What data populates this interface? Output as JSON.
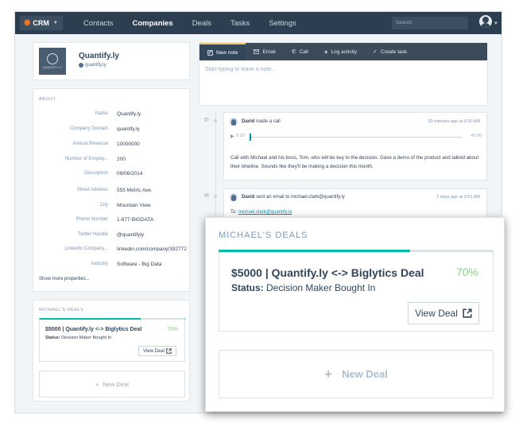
{
  "nav": {
    "brand": "CRM",
    "links": [
      "Contacts",
      "Companies",
      "Deals",
      "Tasks",
      "Settings"
    ],
    "active": "Companies",
    "search_placeholder": "Search"
  },
  "company": {
    "logo_text": "QUANTIFY.LY",
    "name": "Quantify.ly",
    "domain": "quantify.ly"
  },
  "about": {
    "title": "ABOUT",
    "properties": [
      {
        "k": "Name",
        "v": "Quantify.ly"
      },
      {
        "k": "Company Domain",
        "v": "quantify.ly"
      },
      {
        "k": "Annual Revenue",
        "v": "10000000"
      },
      {
        "k": "Number of Employ...",
        "v": "200"
      },
      {
        "k": "Description",
        "v": "09/06/2014"
      },
      {
        "k": "Street Address",
        "v": "555 Metric Ave."
      },
      {
        "k": "City",
        "v": "Mountain View"
      },
      {
        "k": "Phone Number",
        "v": "1-877-BIGDATA"
      },
      {
        "k": "Twitter Handle",
        "v": "@quantifyly"
      },
      {
        "k": "LinkedIn Company...",
        "v": "linkedin.com/company/392772"
      },
      {
        "k": "Industry",
        "v": "Software - Big Data"
      }
    ],
    "show_more": "Show more properties..."
  },
  "deals": {
    "title": "MICHAEL'S DEALS",
    "deal_name": "$5000 | Quantify.ly <-> Biglytics Deal",
    "percent": "70%",
    "progress": 0.7,
    "status_label": "Status:",
    "status_value": "Decision Maker Bought In",
    "view_label": "View Deal",
    "new_deal_label": "New Deal"
  },
  "composer": {
    "tabs": [
      {
        "label": "New note",
        "icon": "pencil-icon"
      },
      {
        "label": "Email",
        "icon": "envelope-icon"
      },
      {
        "label": "Call",
        "icon": "phone-icon"
      },
      {
        "label": "Log activity",
        "icon": "plus-icon"
      },
      {
        "label": "Create task",
        "icon": "check-circle-icon"
      }
    ],
    "placeholder": "Start typing to leave a note..."
  },
  "timeline": {
    "call": {
      "actor": "David",
      "action": "made a call",
      "time": "30 minutes ago at 9:30 AM",
      "start": "0:00",
      "end": "43:45",
      "body": "Call with Michael and his boss, Tom, who will be key to the decision. Gave a demo of the product and talked about their timeline. Sounds like they'll be making a decision this month."
    },
    "email": {
      "actor": "David",
      "action": "sent an email to michael.clark@quantify.ly",
      "time": "2 days ago at 9:51 AM",
      "to_label": "To:",
      "to_value": "michael.clark@quantify.ly"
    }
  }
}
